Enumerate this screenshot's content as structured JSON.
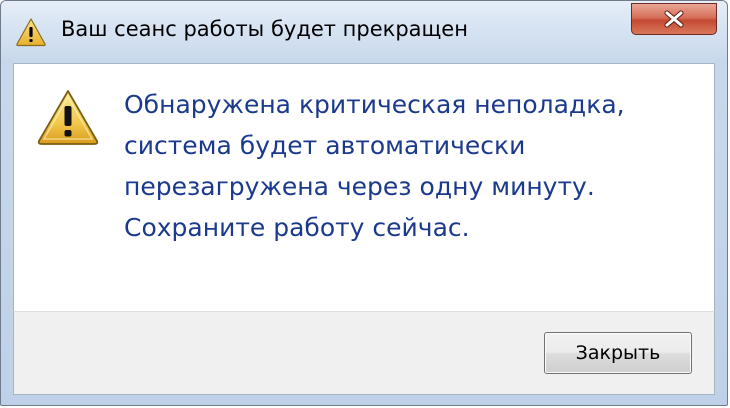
{
  "window": {
    "title": "Ваш сеанс работы будет прекращен",
    "title_icon": "warning-icon",
    "close_icon": "close-icon"
  },
  "message": {
    "icon": "warning-icon",
    "lines": [
      "Обнаружена критическая неполадка,",
      "система будет автоматически",
      "перезагружена через одну минуту.",
      "Сохраните работу сейчас."
    ]
  },
  "buttons": {
    "close_label": "Закрыть"
  },
  "colors": {
    "message_text": "#1b3a8c",
    "close_button": "#c44a32",
    "warning_fill": "#f2c94c"
  }
}
